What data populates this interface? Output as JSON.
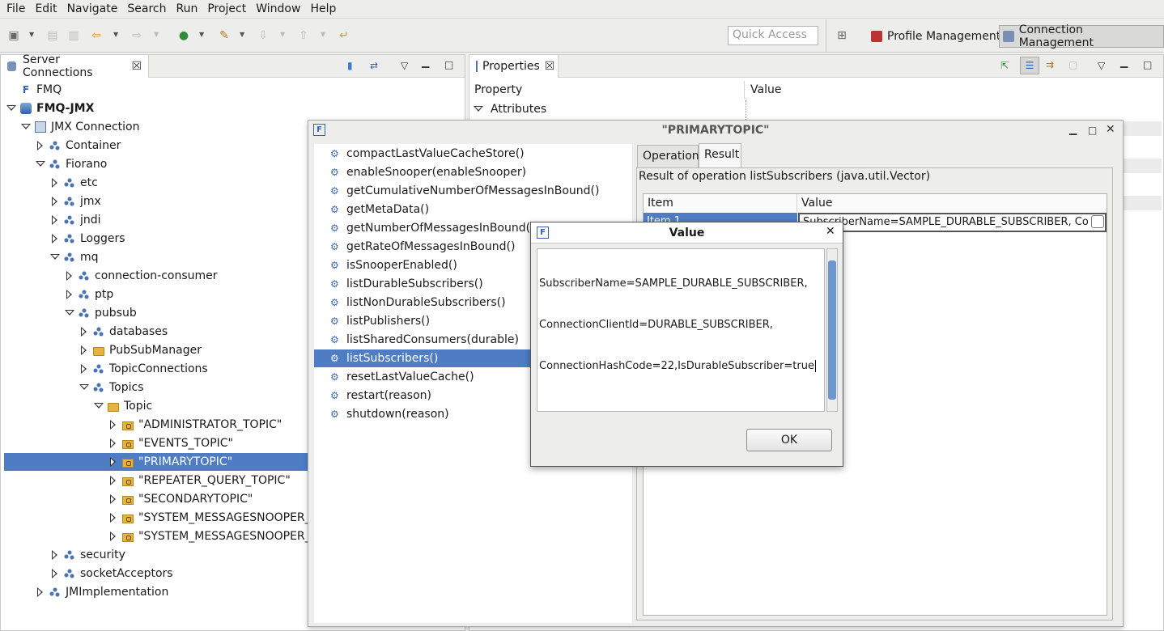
{
  "menu": [
    "File",
    "Edit",
    "Navigate",
    "Search",
    "Run",
    "Project",
    "Window",
    "Help"
  ],
  "quick_access_placeholder": "Quick Access",
  "perspectives": {
    "profile": "Profile Management",
    "connection": "Connection Management"
  },
  "left_view": {
    "title": "Server Connections",
    "tree": [
      {
        "label": "FMQ",
        "level": 0,
        "toggle": "none",
        "icon": "fmq-icon",
        "bold": false
      },
      {
        "label": "FMQ-JMX",
        "level": 0,
        "toggle": "open",
        "icon": "database-icon",
        "bold": true
      },
      {
        "label": "JMX Connection",
        "level": 1,
        "toggle": "open",
        "icon": "jmx-connection-icon",
        "bold": false
      },
      {
        "label": "Container",
        "level": 2,
        "toggle": "closed",
        "icon": "node-icon",
        "bold": false
      },
      {
        "label": "Fiorano",
        "level": 2,
        "toggle": "open",
        "icon": "node-icon",
        "bold": false
      },
      {
        "label": "etc",
        "level": 3,
        "toggle": "closed",
        "icon": "node-icon",
        "bold": false
      },
      {
        "label": "jmx",
        "level": 3,
        "toggle": "closed",
        "icon": "node-icon",
        "bold": false
      },
      {
        "label": "jndi",
        "level": 3,
        "toggle": "closed",
        "icon": "node-icon",
        "bold": false
      },
      {
        "label": "Loggers",
        "level": 3,
        "toggle": "closed",
        "icon": "node-icon",
        "bold": false
      },
      {
        "label": "mq",
        "level": 3,
        "toggle": "open",
        "icon": "node-icon",
        "bold": false
      },
      {
        "label": "connection-consumer",
        "level": 4,
        "toggle": "closed",
        "icon": "node-icon",
        "bold": false
      },
      {
        "label": "ptp",
        "level": 4,
        "toggle": "closed",
        "icon": "node-icon",
        "bold": false
      },
      {
        "label": "pubsub",
        "level": 4,
        "toggle": "open",
        "icon": "node-icon",
        "bold": false
      },
      {
        "label": "databases",
        "level": 5,
        "toggle": "closed",
        "icon": "node-icon",
        "bold": false
      },
      {
        "label": "PubSubManager",
        "level": 5,
        "toggle": "closed",
        "icon": "folder-icon",
        "bold": false
      },
      {
        "label": "TopicConnections",
        "level": 5,
        "toggle": "closed",
        "icon": "node-icon",
        "bold": false
      },
      {
        "label": "Topics",
        "level": 5,
        "toggle": "open",
        "icon": "node-icon",
        "bold": false
      },
      {
        "label": "Topic",
        "level": 6,
        "toggle": "open",
        "icon": "folder-icon",
        "bold": false
      },
      {
        "label": "\"ADMINISTRATOR_TOPIC\"",
        "level": 7,
        "toggle": "closed",
        "icon": "topic-folder-icon",
        "bold": false
      },
      {
        "label": "\"EVENTS_TOPIC\"",
        "level": 7,
        "toggle": "closed",
        "icon": "topic-folder-icon",
        "bold": false
      },
      {
        "label": "\"PRIMARYTOPIC\"",
        "level": 7,
        "toggle": "closed",
        "icon": "topic-folder-icon",
        "bold": false,
        "selected": true
      },
      {
        "label": "\"REPEATER_QUERY_TOPIC\"",
        "level": 7,
        "toggle": "closed",
        "icon": "topic-folder-icon",
        "bold": false
      },
      {
        "label": "\"SECONDARYTOPIC\"",
        "level": 7,
        "toggle": "closed",
        "icon": "topic-folder-icon",
        "bold": false
      },
      {
        "label": "\"SYSTEM_MESSAGESNOOPER_Q",
        "level": 7,
        "toggle": "closed",
        "icon": "topic-folder-icon",
        "bold": false
      },
      {
        "label": "\"SYSTEM_MESSAGESNOOPER_T(",
        "level": 7,
        "toggle": "closed",
        "icon": "topic-folder-icon",
        "bold": false
      },
      {
        "label": "security",
        "level": 3,
        "toggle": "closed",
        "icon": "node-icon",
        "bold": false
      },
      {
        "label": "socketAcceptors",
        "level": 3,
        "toggle": "closed",
        "icon": "node-icon",
        "bold": false
      },
      {
        "label": "JMImplementation",
        "level": 2,
        "toggle": "closed",
        "icon": "node-icon",
        "bold": false
      }
    ]
  },
  "right_view": {
    "title": "Properties",
    "col_property": "Property",
    "col_value": "Value",
    "group": "Attributes"
  },
  "topic_dialog": {
    "title": "\"PRIMARYTOPIC\"",
    "operations": [
      "compactLastValueCacheStore()",
      "enableSnooper(enableSnooper)",
      "getCumulativeNumberOfMessagesInBound()",
      "getMetaData()",
      "getNumberOfMessagesInBound()",
      "getRateOfMessagesInBound()",
      "isSnooperEnabled()",
      "listDurableSubscribers()",
      "listNonDurableSubscribers()",
      "listPublishers()",
      "listSharedConsumers(durable)",
      "listSubscribers()",
      "resetLastValueCache()",
      "restart(reason)",
      "shutdown(reason)"
    ],
    "selected_operation_index": 11,
    "tabs": [
      "Operation",
      "Result"
    ],
    "active_tab": "Result",
    "result_caption": "Result of operation listSubscribers (java.util.Vector)",
    "table": {
      "col_item": "Item",
      "col_value": "Value",
      "row_item": "Item 1",
      "row_value": "SubscriberName=SAMPLE_DURABLE_SUBSCRIBER, Co"
    }
  },
  "value_dialog": {
    "title": "Value",
    "text_lines": [
      "SubscriberName=SAMPLE_DURABLE_SUBSCRIBER,",
      "ConnectionClientId=DURABLE_SUBSCRIBER,",
      "ConnectionHashCode=22,IsDurableSubscriber=true"
    ],
    "ok_label": "OK"
  },
  "colors": {
    "selection": "#4f7dc4",
    "accent": "#3f6ab0"
  }
}
